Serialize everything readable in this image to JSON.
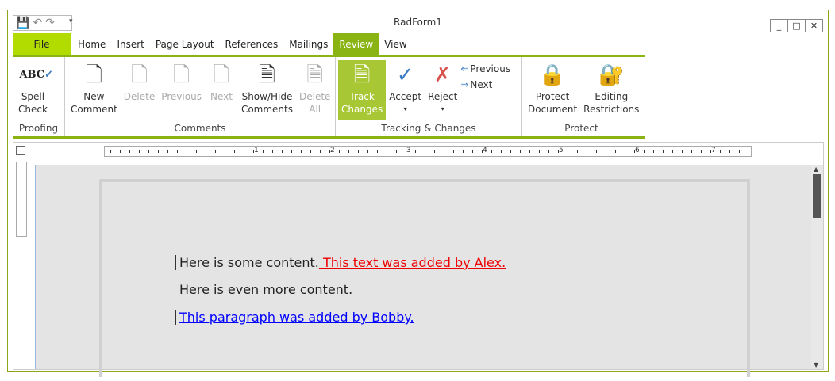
{
  "window": {
    "title": "RadForm1",
    "minimize": "_",
    "maximize": "□",
    "close": "✕"
  },
  "qat": {
    "save": "💾",
    "undo": "↶",
    "redo": "↷",
    "dropdown": "▾"
  },
  "tabs": [
    "File",
    "Home",
    "Insert",
    "Page Layout",
    "References",
    "Mailings",
    "Review",
    "View"
  ],
  "ribbon": {
    "proofing": {
      "label": "Proofing",
      "spell": [
        "Spell",
        "Check"
      ]
    },
    "comments": {
      "label": "Comments",
      "new": [
        "New",
        "Comment"
      ],
      "delete": "Delete",
      "previous": "Previous",
      "next": "Next",
      "showhide": [
        "Show/Hide",
        "Comments"
      ],
      "delete_all": "Delete All"
    },
    "tracking": {
      "label": "Tracking & Changes",
      "track": [
        "Track",
        "Changes"
      ],
      "accept": "Accept",
      "reject": "Reject",
      "previous": "Previous",
      "next": "Next",
      "arrow": "▾"
    },
    "protect": {
      "label": "Protect",
      "protect_doc": [
        "Protect",
        "Document"
      ],
      "editing": [
        "Editing",
        "Restrictions"
      ]
    }
  },
  "ruler": {
    "numbers": [
      "1",
      "2",
      "3",
      "4",
      "5",
      "6",
      "7"
    ]
  },
  "document": {
    "p1": "Here is some content.",
    "p1_insert": " This text was added by Alex.",
    "p2": "Here is even more content.",
    "p3_insert": "This paragraph was added by Bobby."
  },
  "colors": {
    "accent": "#8ab414",
    "file": "#b2db00",
    "insert_red": "#ee0000",
    "insert_blue": "#0000ff"
  }
}
